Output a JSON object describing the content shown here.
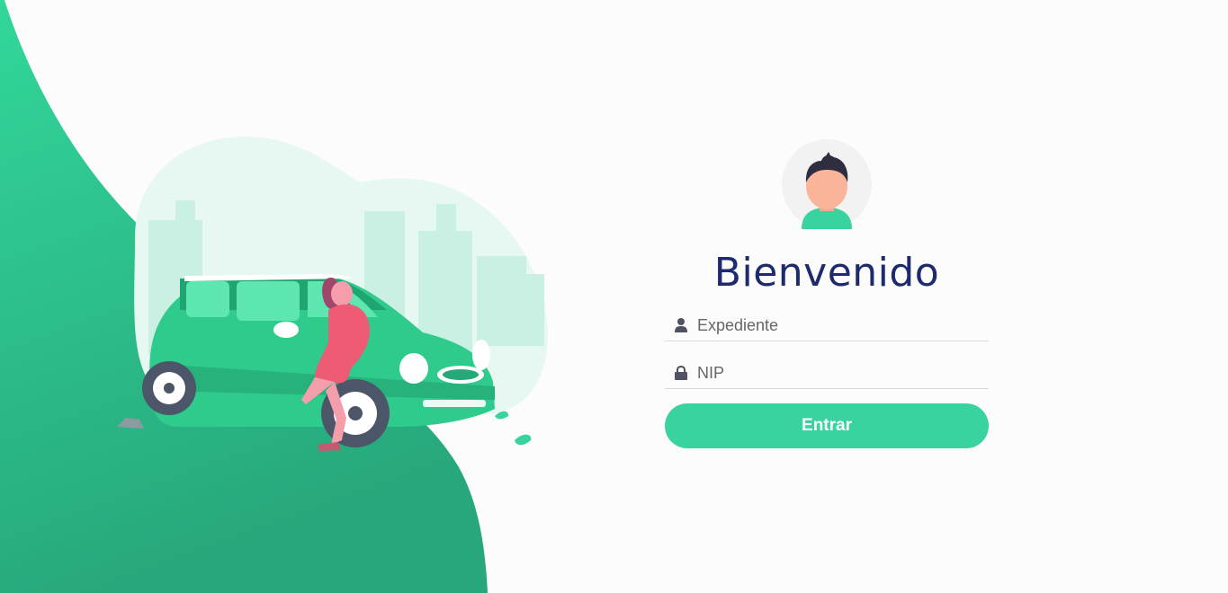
{
  "login": {
    "title": "Bienvenido",
    "expediente_placeholder": "Expediente",
    "expediente_value": "",
    "nip_placeholder": "NIP",
    "nip_value": "",
    "submit_label": "Entrar"
  },
  "icons": {
    "avatar": "user-avatar-icon",
    "user_field": "user-icon",
    "password_field": "lock-icon"
  },
  "colors": {
    "accent": "#38d39f",
    "title": "#1d2a6e",
    "background": "#fcfcfc"
  }
}
